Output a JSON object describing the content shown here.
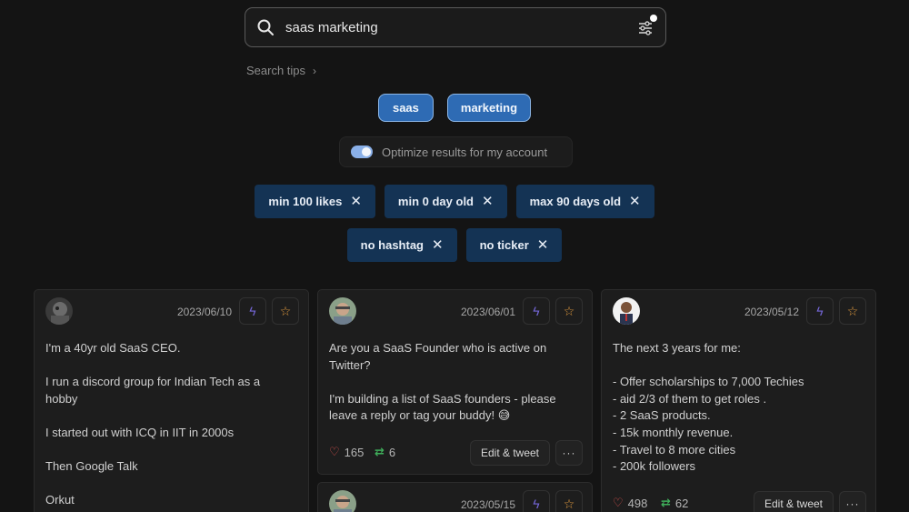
{
  "search": {
    "query": "saas marketing",
    "placeholder": ""
  },
  "search_tips": {
    "label": "Search tips",
    "chevron": "›"
  },
  "keywords": [
    "saas",
    "marketing"
  ],
  "optimize": {
    "label": "Optimize results for my account",
    "enabled": true
  },
  "filters_row1": [
    {
      "label": "min 100 likes",
      "close": "✕"
    },
    {
      "label": "min 0 day old",
      "close": "✕"
    },
    {
      "label": "max 90 days old",
      "close": "✕"
    }
  ],
  "filters_row2": [
    {
      "label": "no hashtag",
      "close": "✕"
    },
    {
      "label": "no ticker",
      "close": "✕"
    }
  ],
  "icons": {
    "bolt": "ϟ",
    "star": "☆",
    "heart": "♡",
    "retweet": "⇄",
    "more": "···"
  },
  "cards": [
    {
      "date": "2023/06/10",
      "text": "I'm a 40yr old SaaS CEO.\n\nI run a discord group for Indian Tech as a hobby\n\nI started out with ICQ in IIT in 2000s\n\nThen Google Talk\n\nOrkut"
    },
    {
      "date": "2023/06/01",
      "text": "Are you a SaaS Founder who is active on Twitter?\n\nI'm building a list of SaaS founders - please leave a reply or tag your buddy! 😅",
      "likes": "165",
      "retweets": "6",
      "edit_label": "Edit & tweet"
    },
    {
      "date": "2023/05/12",
      "text": "The next 3 years for me:\n\n- Offer scholarships to 7,000 Techies\n- aid 2/3 of them to get roles .\n- 2 SaaS products.\n- 15k monthly revenue.\n- Travel to 8 more cities\n- 200k followers",
      "likes": "498",
      "retweets": "62",
      "edit_label": "Edit & tweet"
    },
    {
      "date": "2023/05/15"
    }
  ]
}
